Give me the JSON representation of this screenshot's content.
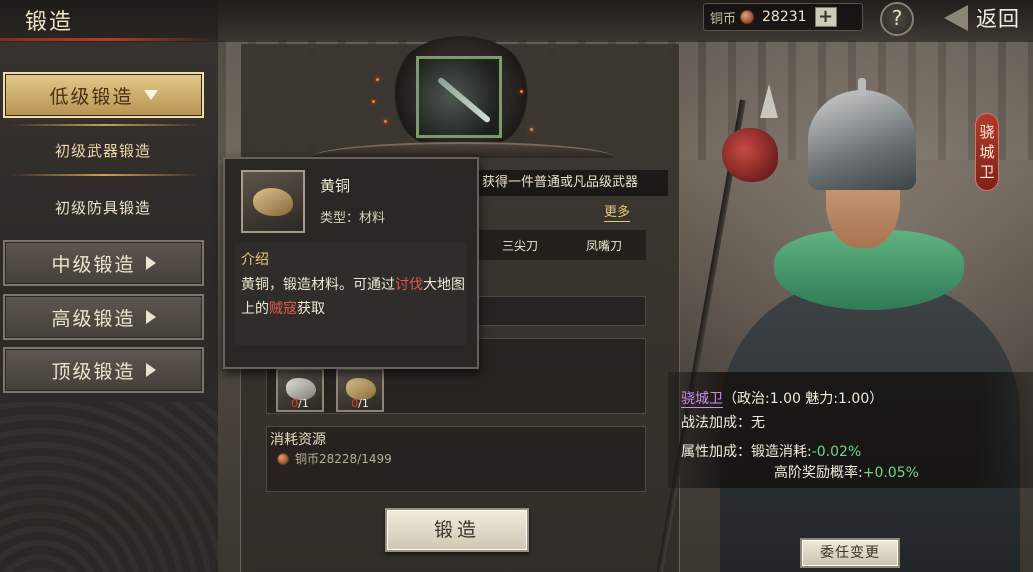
{
  "header": {
    "title": "锻造",
    "currency_label": "铜币",
    "currency_value": "28231",
    "add_label": "+",
    "help_label": "?",
    "back_label": "返回"
  },
  "menu": {
    "low_tier": "低级锻造",
    "sub_weapon": "初级武器锻造",
    "sub_armor": "初级防具锻造",
    "mid_tier": "中级锻造",
    "high_tier": "高级锻造",
    "top_tier": "顶级锻造"
  },
  "forge": {
    "obtain_text": "获得一件普通或凡品级武器",
    "more_label": "更多",
    "candidates": [
      "三尖刀",
      "凤嘴刀"
    ],
    "materials": [
      {
        "have": "0",
        "need": "/1",
        "icon": "silver-ore-icon"
      },
      {
        "have": "0",
        "need": "/1",
        "icon": "bronze-ore-icon"
      }
    ],
    "cost_title": "消耗资源",
    "cost_label": "铜币28228/1499",
    "forge_button": "锻造"
  },
  "tooltip": {
    "name": "黄铜",
    "type": "类型：材料",
    "desc_title": "介绍",
    "desc_part1": "黄铜，锻造材料。可通过",
    "desc_hl1": "讨伐",
    "desc_part2": "大地图上的",
    "desc_hl2": "贼寇",
    "desc_part3": "获取"
  },
  "character": {
    "rank_tag": [
      "骁",
      "城",
      "卫"
    ],
    "name": "骁城卫",
    "attrs": "（政治:1.00 魅力:1.00）",
    "tactic_label": "战法加成：",
    "tactic_value": "无",
    "attr_label": "属性加成：",
    "forge_cost_label": "锻造消耗:",
    "forge_cost_value": "-0.02%",
    "bonus_label": "高阶奖励概率:",
    "bonus_value": "+0.05%",
    "appoint_button": "委任变更"
  },
  "colors": {
    "accent_gold": "#e3c98a",
    "highlight_red": "#e25a51",
    "bonus_green": "#74d38a",
    "name_purple": "#c98be8"
  }
}
